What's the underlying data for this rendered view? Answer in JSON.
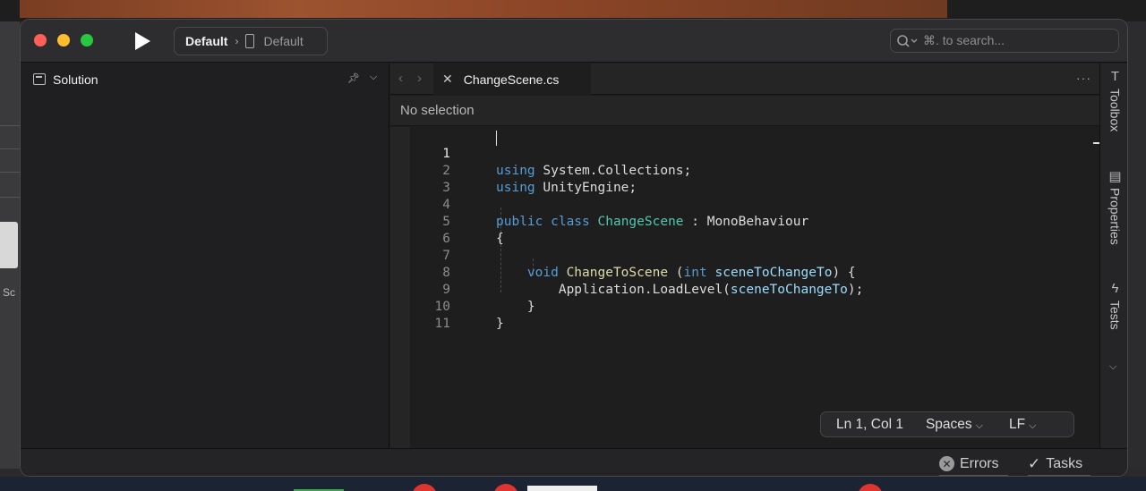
{
  "toolbar": {
    "config_name": "Default",
    "device_name": "Default",
    "search_placeholder": "⌘. to search..."
  },
  "solution_pad": {
    "title": "Solution"
  },
  "editor": {
    "tab_filename": "ChangeScene.cs",
    "path_bar": "No selection",
    "current_line": 1,
    "line_numbers": [
      "1",
      "2",
      "3",
      "4",
      "5",
      "6",
      "7",
      "8",
      "9",
      "10",
      "11"
    ],
    "code": {
      "l1_kw": "using",
      "l1_rest": " System.Collections;",
      "l2_kw": "using",
      "l2_rest": " UnityEngine;",
      "l4_kw": "public class",
      "l4_type": "ChangeScene",
      "l4_rest": " : MonoBehaviour",
      "l5": "{",
      "l7_kw": "void",
      "l7_fn": "ChangeToScene",
      "l7_open": " (",
      "l7_kw2": "int",
      "l7_param": "sceneToChangeTo",
      "l7_close": ") {",
      "l8_obj": "Application.LoadLevel(",
      "l8_param": "sceneToChangeTo",
      "l8_close": ");",
      "l9": "}",
      "l10": "}"
    }
  },
  "status": {
    "position": "Ln 1, Col 1",
    "indent": "Spaces",
    "line_ending": "LF"
  },
  "right_dock": {
    "toolbox": "Toolbox",
    "properties": "Properties",
    "tests": "Tests"
  },
  "bottom_bar": {
    "errors": "Errors",
    "tasks": "Tasks"
  },
  "desktop": {
    "left_fragment": "Sc"
  },
  "colors": {
    "keyword": "#569cd6",
    "type": "#4ec9b0",
    "function": "#dcdcaa",
    "parameter": "#9cdcfe"
  }
}
